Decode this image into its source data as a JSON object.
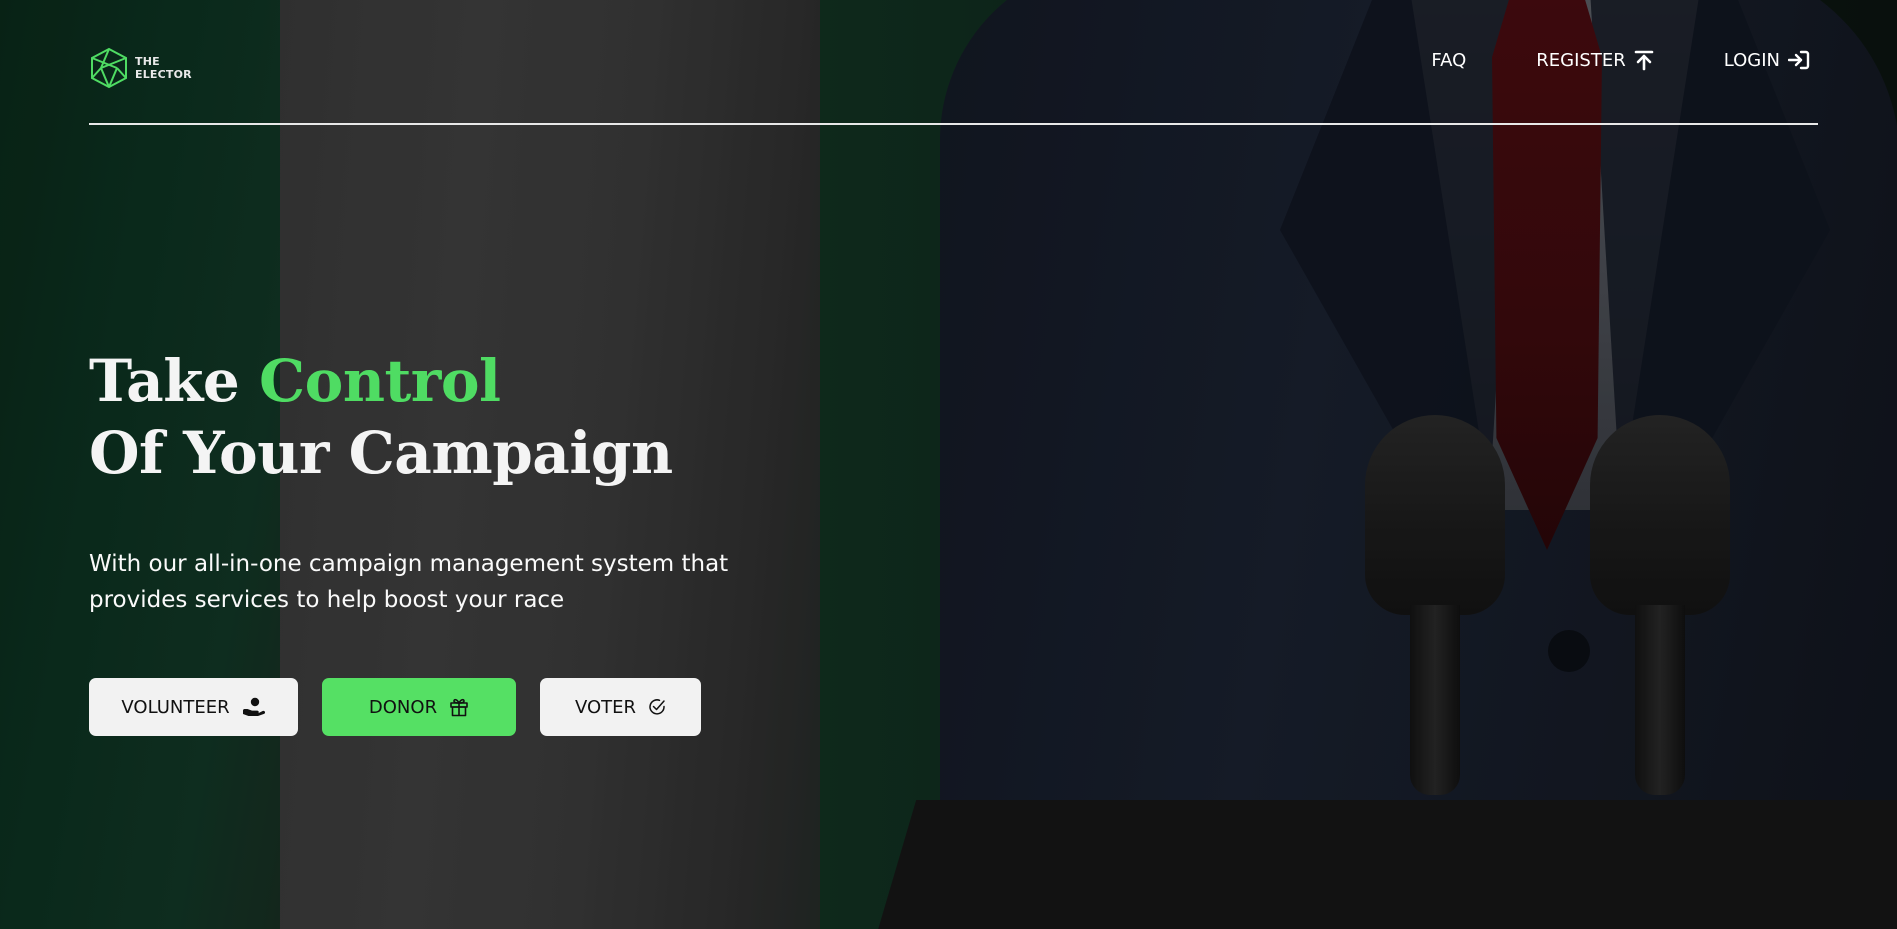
{
  "header": {
    "logo_text": "THE ELECTOR",
    "nav": {
      "faq": "FAQ",
      "register": "REGISTER",
      "login": "LOGIN"
    }
  },
  "hero": {
    "headline_part1": "Take",
    "headline_accent": "Control",
    "headline_line2": "Of Your Campaign",
    "subtext": "With our all-in-one campaign management system that provides services to help boost your race"
  },
  "cta": {
    "volunteer": "VOLUNTEER",
    "donor": "DONOR",
    "voter": "VOTER"
  },
  "colors": {
    "accent": "#4fdc63",
    "button_green": "#55e064",
    "button_light": "#f2f2f2"
  },
  "icons": {
    "logo": "hexagon-logo-icon",
    "register": "upload-arrow-icon",
    "login": "login-arrow-icon",
    "volunteer": "hand-helping-icon",
    "donor": "gift-icon",
    "voter": "check-badge-icon"
  }
}
